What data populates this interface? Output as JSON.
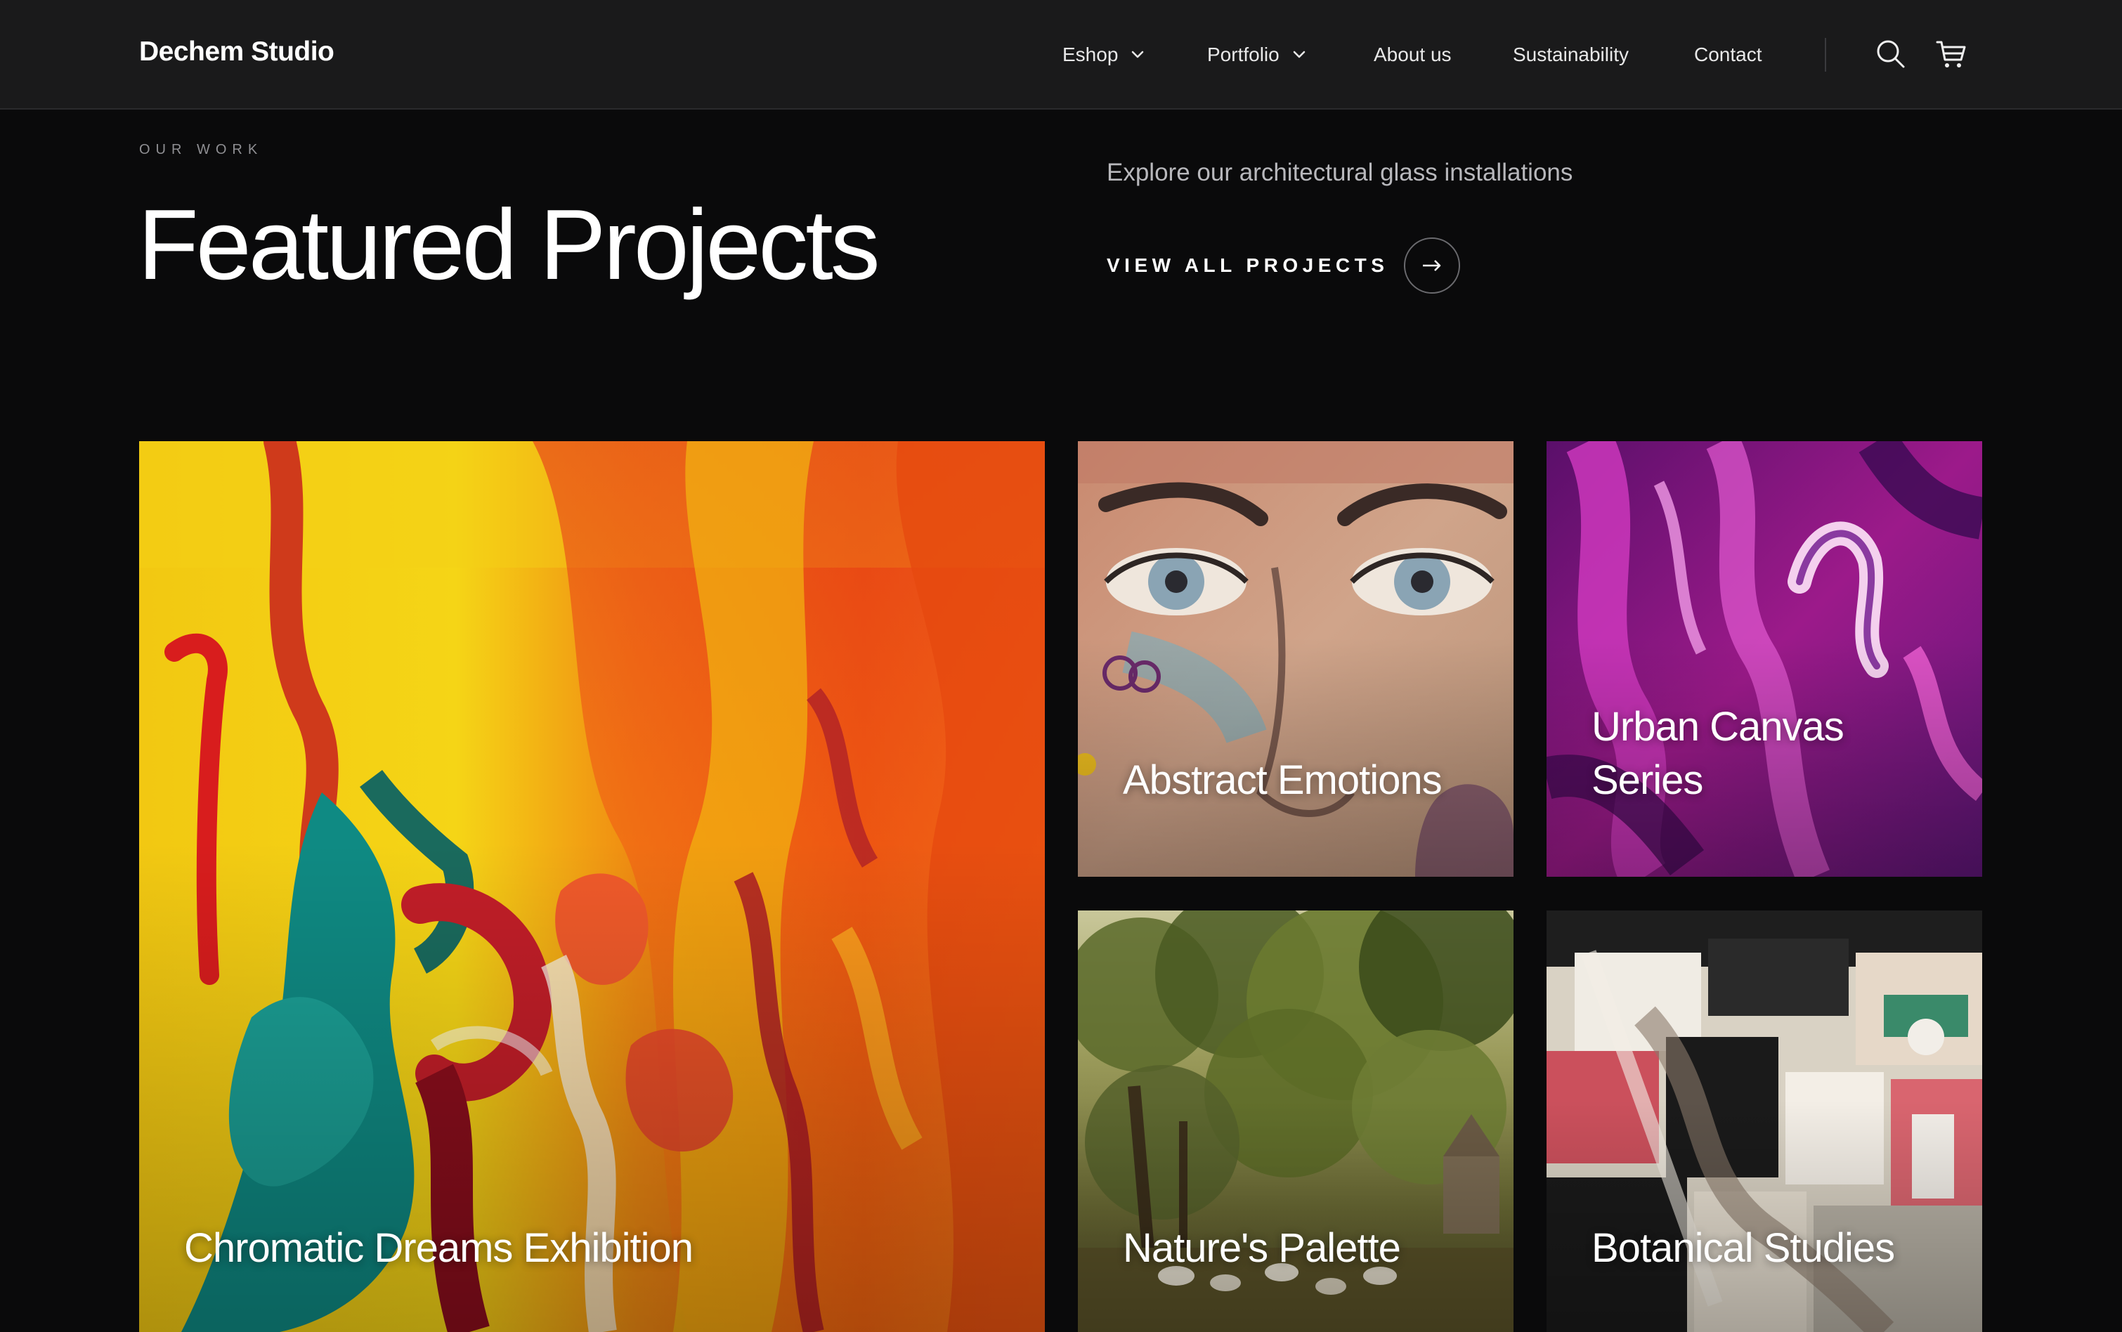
{
  "header": {
    "brand": "Dechem Studio",
    "nav": [
      {
        "label": "Eshop",
        "has_dropdown": true
      },
      {
        "label": "Portfolio",
        "has_dropdown": true
      },
      {
        "label": "About us",
        "has_dropdown": false
      },
      {
        "label": "Sustainability",
        "has_dropdown": false
      },
      {
        "label": "Contact",
        "has_dropdown": false
      }
    ],
    "icons": [
      "search-icon",
      "cart-icon"
    ]
  },
  "hero": {
    "eyebrow": "OUR WORK",
    "title": "Featured Projects",
    "subtitle": "Explore our architectural glass installations",
    "cta_label": "VIEW ALL PROJECTS",
    "cta_icon": "arrow-right-icon"
  },
  "projects": [
    {
      "title": "Chromatic Dreams Exhibition",
      "image": "abstract yellow, orange, red and teal impasto painting"
    },
    {
      "title": "Abstract Emotions",
      "image": "street art face with pale eyes"
    },
    {
      "title": "Urban Canvas Series",
      "image": "swirling magenta and purple fluid art"
    },
    {
      "title": "Nature's Palette",
      "image": "classical landscape painting with trees and sheep"
    },
    {
      "title": "Botanical Studies",
      "image": "torn poster collage wall"
    }
  ],
  "colors": {
    "header_bg": "#1a1a1b",
    "page_bg": "#0a0a0b",
    "text_primary": "#ffffff",
    "text_muted": "#b8b8bc",
    "eyebrow": "#8f8f93"
  }
}
